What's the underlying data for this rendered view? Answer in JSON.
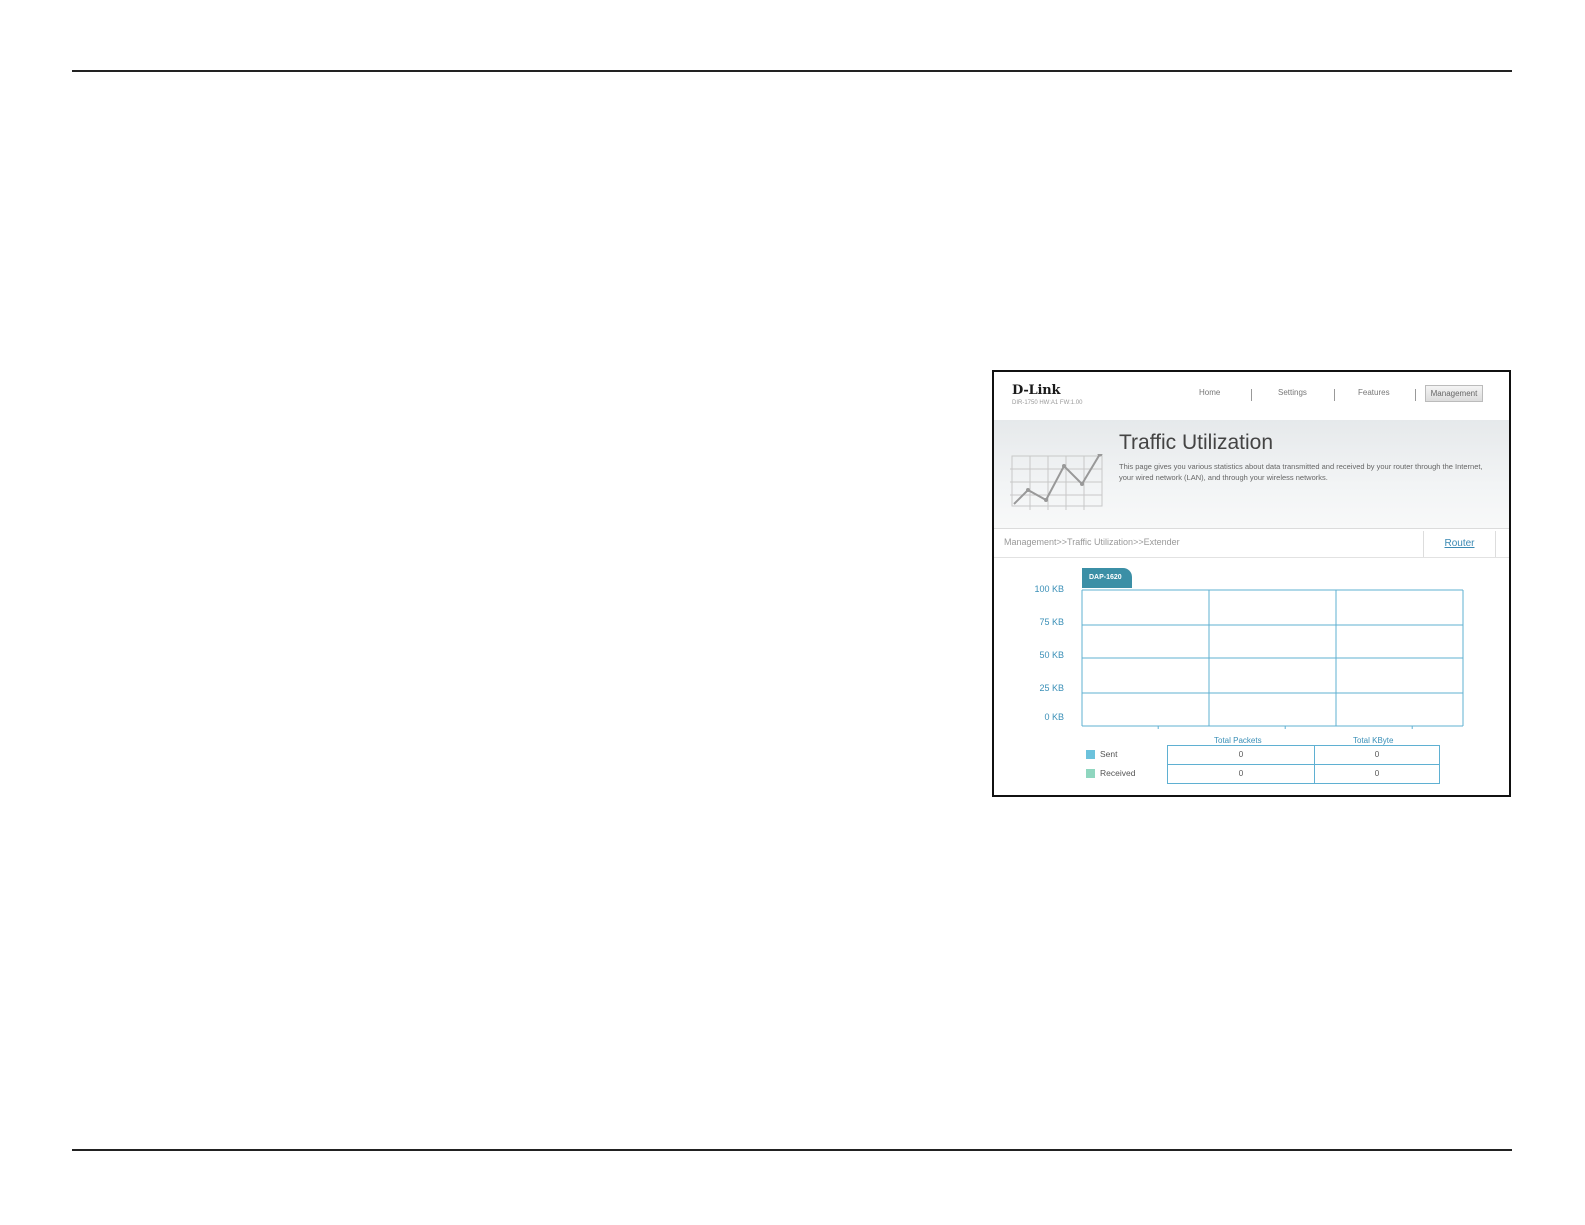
{
  "brand": {
    "logo_text": "D-Link",
    "firmware": "DIR-1750 HW:A1 FW:1.00"
  },
  "nav": {
    "items": [
      "Home",
      "Settings",
      "Features"
    ],
    "active": "Management"
  },
  "banner": {
    "title": "Traffic Utilization",
    "description": "This page gives you various statistics about data transmitted and received by your router through the Internet, your wired network (LAN), and through your wireless networks."
  },
  "breadcrumb": "Management>>Traffic Utilization>>Extender",
  "router_link": "Router",
  "device_tab": "DAP-1620",
  "chart_data": {
    "type": "line",
    "title": "",
    "xlabel": "",
    "ylabel": "",
    "y_ticks": [
      "100 KB",
      "75 KB",
      "50 KB",
      "25 KB",
      "0 KB"
    ],
    "ylim": [
      0,
      100
    ],
    "grid": true,
    "series": [
      {
        "name": "Sent",
        "values": [],
        "color": "#6cc2dc"
      },
      {
        "name": "Received",
        "values": [],
        "color": "#8fd6bf"
      }
    ]
  },
  "stats": {
    "headers": [
      "Total Packets",
      "Total KByte"
    ],
    "rows": [
      {
        "label": "Sent",
        "color": "#6cc2dc",
        "packets": "0",
        "kbytes": "0"
      },
      {
        "label": "Received",
        "color": "#8fd6bf",
        "packets": "0",
        "kbytes": "0"
      }
    ]
  }
}
